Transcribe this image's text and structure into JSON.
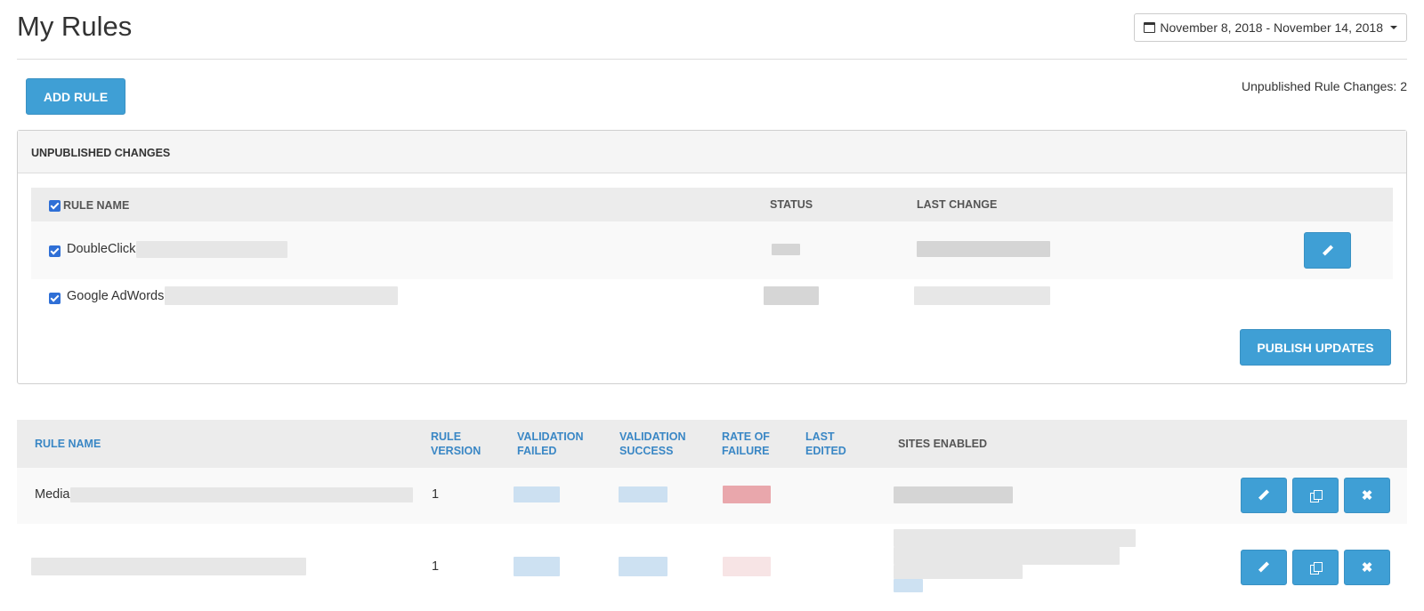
{
  "header": {
    "title": "My Rules",
    "date_range": "November 8, 2018 - November 14, 2018"
  },
  "toolbar": {
    "add_rule_label": "ADD RULE",
    "unpublished_label": "Unpublished Rule Changes: 2"
  },
  "unpublished": {
    "heading": "UNPUBLISHED CHANGES",
    "columns": [
      "RULE NAME",
      "STATUS",
      "LAST CHANGE"
    ],
    "rows": [
      {
        "name": "DoubleClick",
        "checked": true
      },
      {
        "name": "Google AdWords",
        "checked": true
      }
    ],
    "publish_label": "PUBLISH UPDATES"
  },
  "rules": {
    "columns": {
      "rule_name": "RULE NAME",
      "rule_version": [
        "RULE",
        "VERSION"
      ],
      "validation_failed": [
        "VALIDATION",
        "FAILED"
      ],
      "validation_success": [
        "VALIDATION",
        "SUCCESS"
      ],
      "rate_of_failure": [
        "RATE OF",
        "FAILURE"
      ],
      "last_edited": [
        "LAST",
        "EDITED"
      ],
      "sites_enabled": "SITES ENABLED"
    },
    "rows": [
      {
        "name": "Media",
        "version": "1"
      },
      {
        "name": "",
        "version": "1"
      }
    ]
  },
  "icons": [
    "calendar-icon",
    "caret-down-icon",
    "pencil-icon",
    "copy-icon",
    "close-icon",
    "checkbox-icon"
  ],
  "colors": {
    "accent": "#3f9fd5",
    "link_header": "#3a87c5",
    "failure_high": "#e6999f",
    "failure_low": "#f6dfe1"
  }
}
